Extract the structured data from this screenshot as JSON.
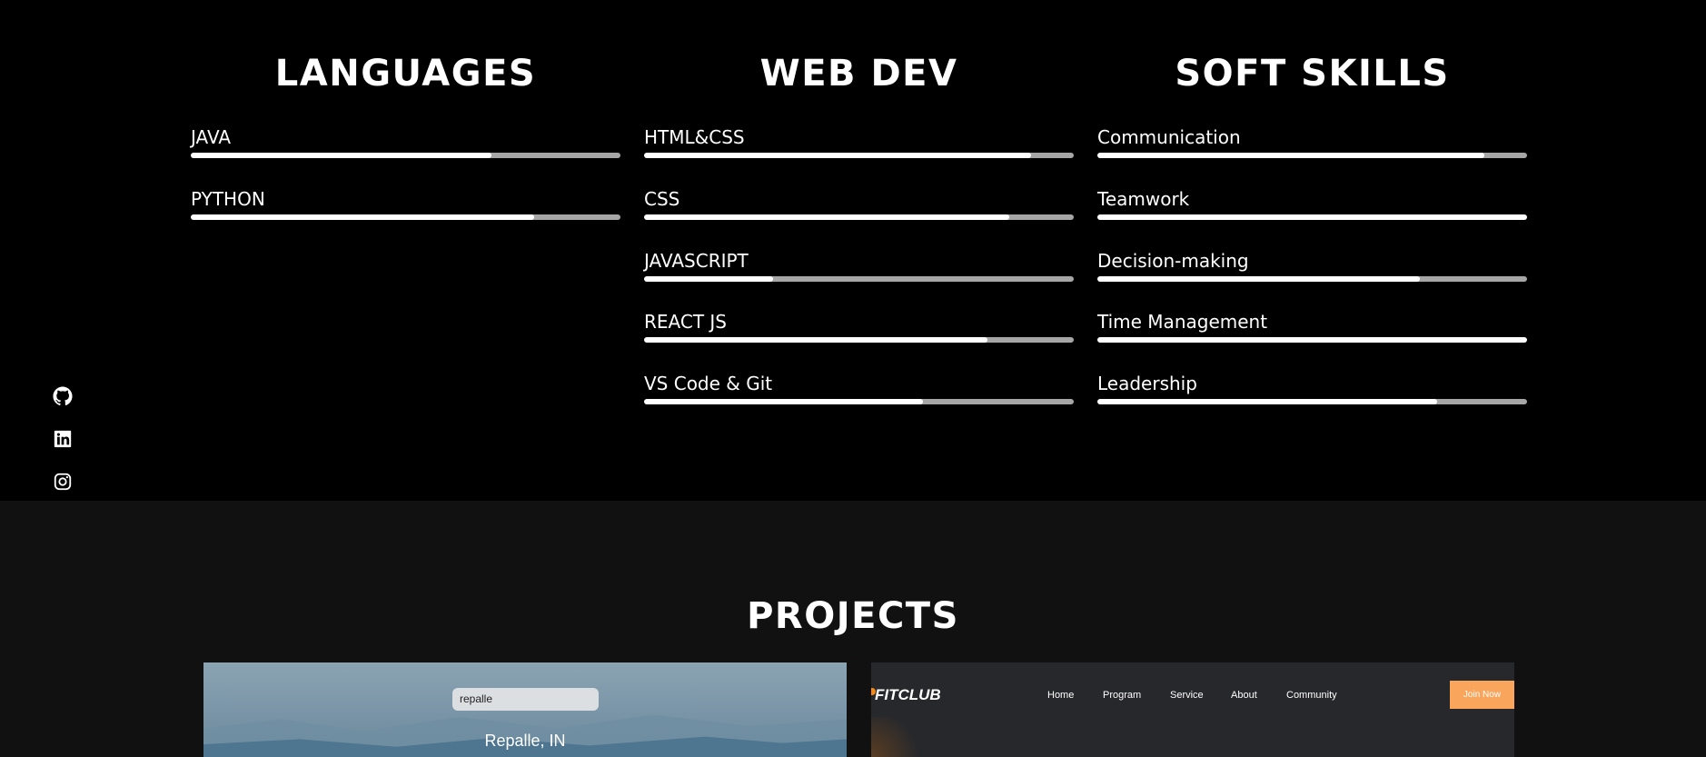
{
  "skills": {
    "languages": {
      "title": "LANGUAGES",
      "items": [
        {
          "label": "JAVA",
          "level": 70
        },
        {
          "label": "PYTHON",
          "level": 80
        }
      ]
    },
    "webdev": {
      "title": "WEB DEV",
      "items": [
        {
          "label": "HTML&CSS",
          "level": 90
        },
        {
          "label": "CSS",
          "level": 85
        },
        {
          "label": "JAVASCRIPT",
          "level": 30
        },
        {
          "label": "REACT JS",
          "level": 80
        },
        {
          "label": "VS Code & Git",
          "level": 65
        }
      ]
    },
    "soft": {
      "title": "SOFT SKILLS",
      "items": [
        {
          "label": "Communication",
          "level": 90
        },
        {
          "label": "Teamwork",
          "level": 100
        },
        {
          "label": "Decision-making",
          "level": 75
        },
        {
          "label": "Time Management",
          "level": 100
        },
        {
          "label": "Leadership",
          "level": 79
        }
      ]
    }
  },
  "social": {
    "icons": [
      "github-icon",
      "linkedin-icon",
      "instagram-icon"
    ]
  },
  "projects": {
    "title": "PROJECTS",
    "weather": {
      "search_value": "repalle",
      "city": "Repalle, IN"
    },
    "fitclub": {
      "logo": "FITCLUB",
      "nav": [
        "Home",
        "Program",
        "Service",
        "About",
        "Community"
      ],
      "join_label": "Join Now",
      "accent": "#f9a55b"
    }
  }
}
